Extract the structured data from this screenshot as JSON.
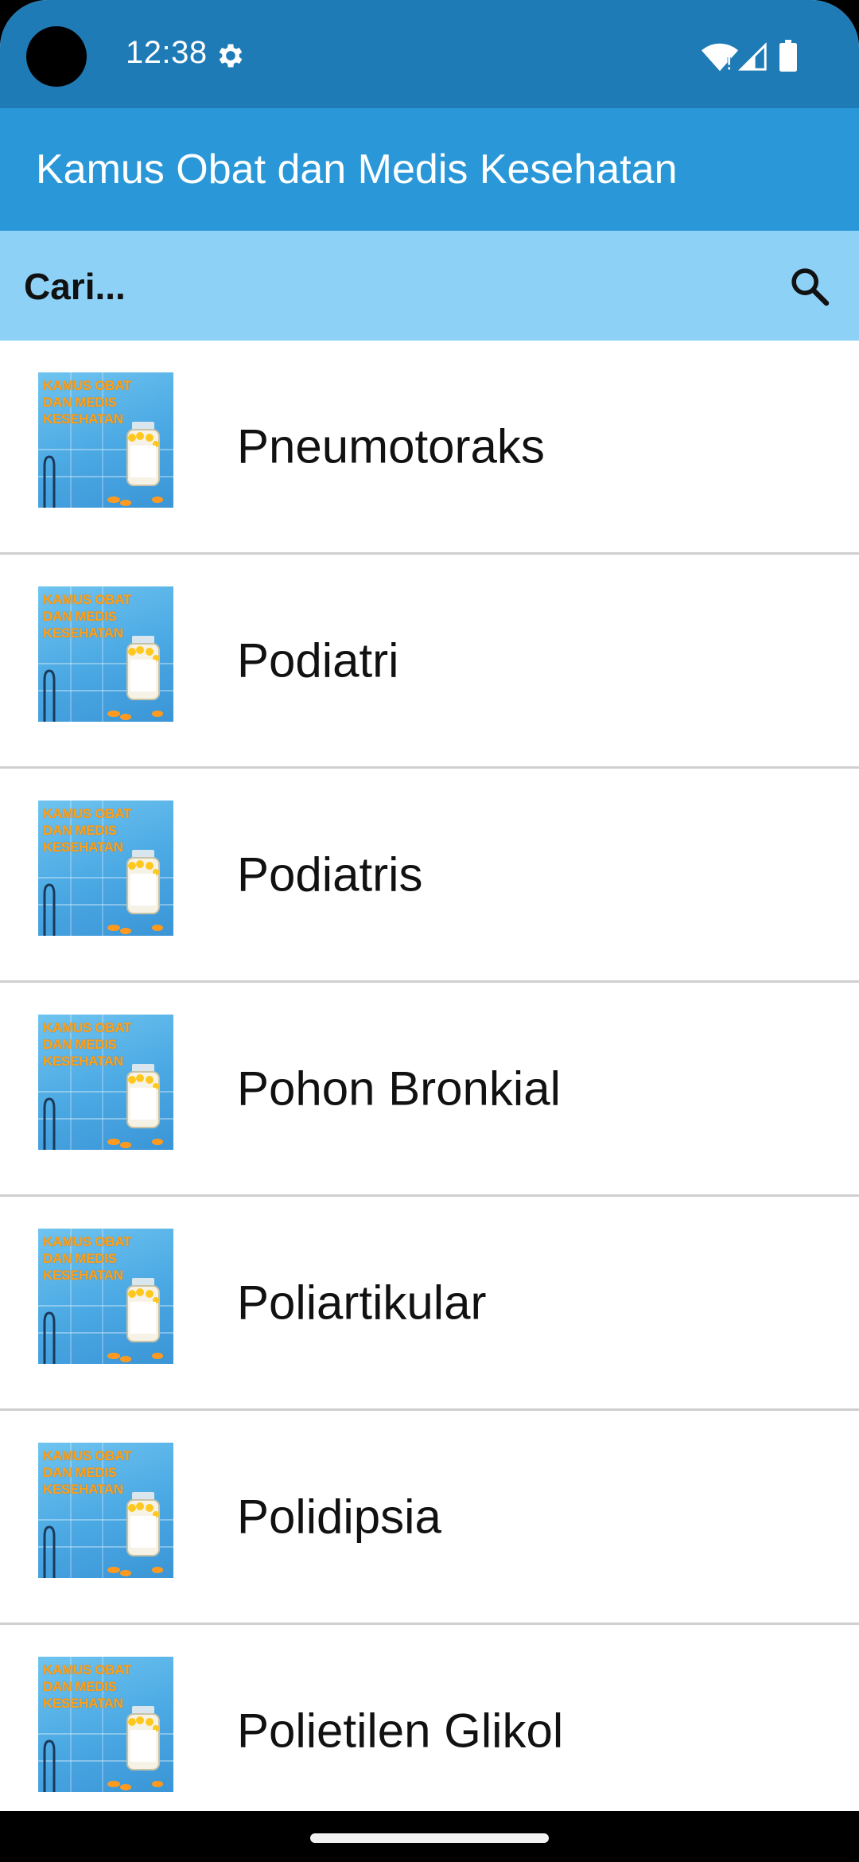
{
  "status_bar": {
    "time": "12:38"
  },
  "app_bar": {
    "title": "Kamus Obat dan Medis Kesehatan"
  },
  "search": {
    "placeholder": "Cari..."
  },
  "list": {
    "thumbnail_text": "KAMUS OBAT DAN MEDIS KESEHATAN",
    "items": [
      {
        "label": "Pneumotoraks"
      },
      {
        "label": "Podiatri"
      },
      {
        "label": "Podiatris"
      },
      {
        "label": "Pohon Bronkial"
      },
      {
        "label": "Poliartikular"
      },
      {
        "label": "Polidipsia"
      },
      {
        "label": "Polietilen Glikol"
      }
    ]
  },
  "colors": {
    "status_bar": "#1f7bb6",
    "app_bar": "#2a98d8",
    "search_bar": "#8dd1f6"
  },
  "icons": [
    "gear-icon",
    "wifi-icon",
    "signal-icon",
    "battery-icon",
    "search-icon"
  ]
}
